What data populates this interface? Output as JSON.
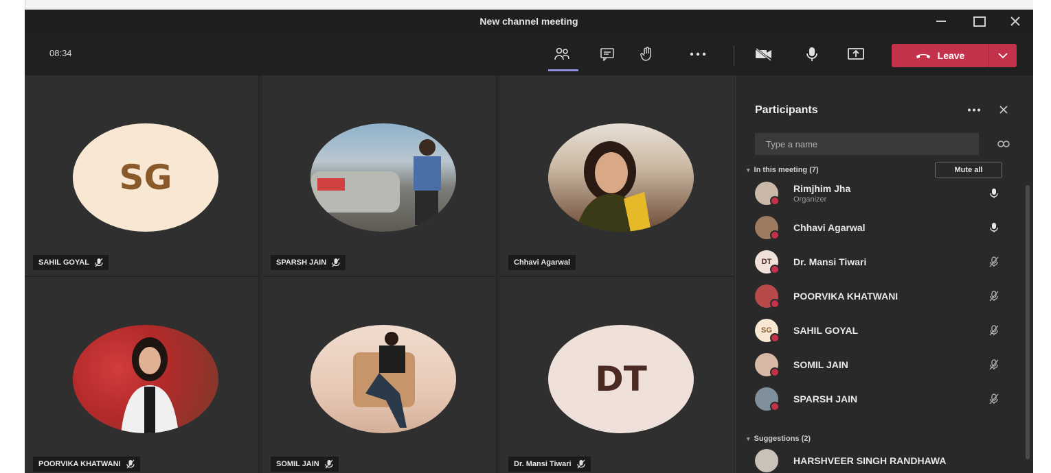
{
  "window": {
    "title": "New channel meeting"
  },
  "toolbar": {
    "timer": "08:34",
    "leave_label": "Leave"
  },
  "tiles": [
    {
      "name": "SAHIL GOYAL",
      "initials": "SG",
      "avatar_bg": "#f8e7d3",
      "initials_color": "#8a5a2b",
      "muted": true
    },
    {
      "name": "SPARSH JAIN",
      "initials": "",
      "avatar_bg": "#7a8e9a",
      "muted": true
    },
    {
      "name": "Chhavi Agarwal",
      "initials": "",
      "avatar_bg": "#8c6a4f",
      "muted": false
    },
    {
      "name": "POORVIKA KHATWANI",
      "initials": "",
      "avatar_bg": "#b83a3a",
      "muted": true
    },
    {
      "name": "SOMIL JAIN",
      "initials": "",
      "avatar_bg": "#e8cfc0",
      "muted": true
    },
    {
      "name": "Dr. Mansi Tiwari",
      "initials": "DT",
      "avatar_bg": "#efe0da",
      "initials_color": "#4a2a22",
      "muted": true
    }
  ],
  "panel": {
    "title": "Participants",
    "search_placeholder": "Type a name",
    "in_meeting_label": "In this meeting (7)",
    "mute_all_label": "Mute all",
    "suggestions_label": "Suggestions (2)",
    "participants": [
      {
        "name": "Rimjhim Jha",
        "role": "Organizer",
        "avatar_bg": "#c9b7a8",
        "initials": "",
        "mic": "on"
      },
      {
        "name": "Chhavi Agarwal",
        "role": "",
        "avatar_bg": "#9b7a5f",
        "initials": "",
        "mic": "on"
      },
      {
        "name": "Dr. Mansi Tiwari",
        "role": "",
        "avatar_bg": "#efe0da",
        "initials": "DT",
        "mic": "off"
      },
      {
        "name": "POORVIKA KHATWANI",
        "role": "",
        "avatar_bg": "#b84a4a",
        "initials": "",
        "mic": "off"
      },
      {
        "name": "SAHIL GOYAL",
        "role": "",
        "avatar_bg": "#f8e7d3",
        "initials": "SG",
        "mic": "off"
      },
      {
        "name": "SOMIL JAIN",
        "role": "",
        "avatar_bg": "#d8b9a5",
        "initials": "",
        "mic": "off"
      },
      {
        "name": "SPARSH JAIN",
        "role": "",
        "avatar_bg": "#7f8f9c",
        "initials": "",
        "mic": "off"
      }
    ],
    "suggestions": [
      {
        "name": "HARSHVEER SINGH RANDHAWA",
        "avatar_bg": "#c8c2b8",
        "initials": ""
      }
    ]
  },
  "colors": {
    "leave_red": "#c4314b",
    "active_tab": "#8d8de0",
    "window_bg": "#2b2b2b"
  },
  "icons": [
    "participants-icon",
    "chat-icon",
    "raise-hand-icon",
    "more-options-icon",
    "camera-off-icon",
    "microphone-icon",
    "share-screen-icon",
    "phone-hangup-icon",
    "chevron-down-icon",
    "close-icon",
    "share-link-icon",
    "mic-off-icon"
  ]
}
